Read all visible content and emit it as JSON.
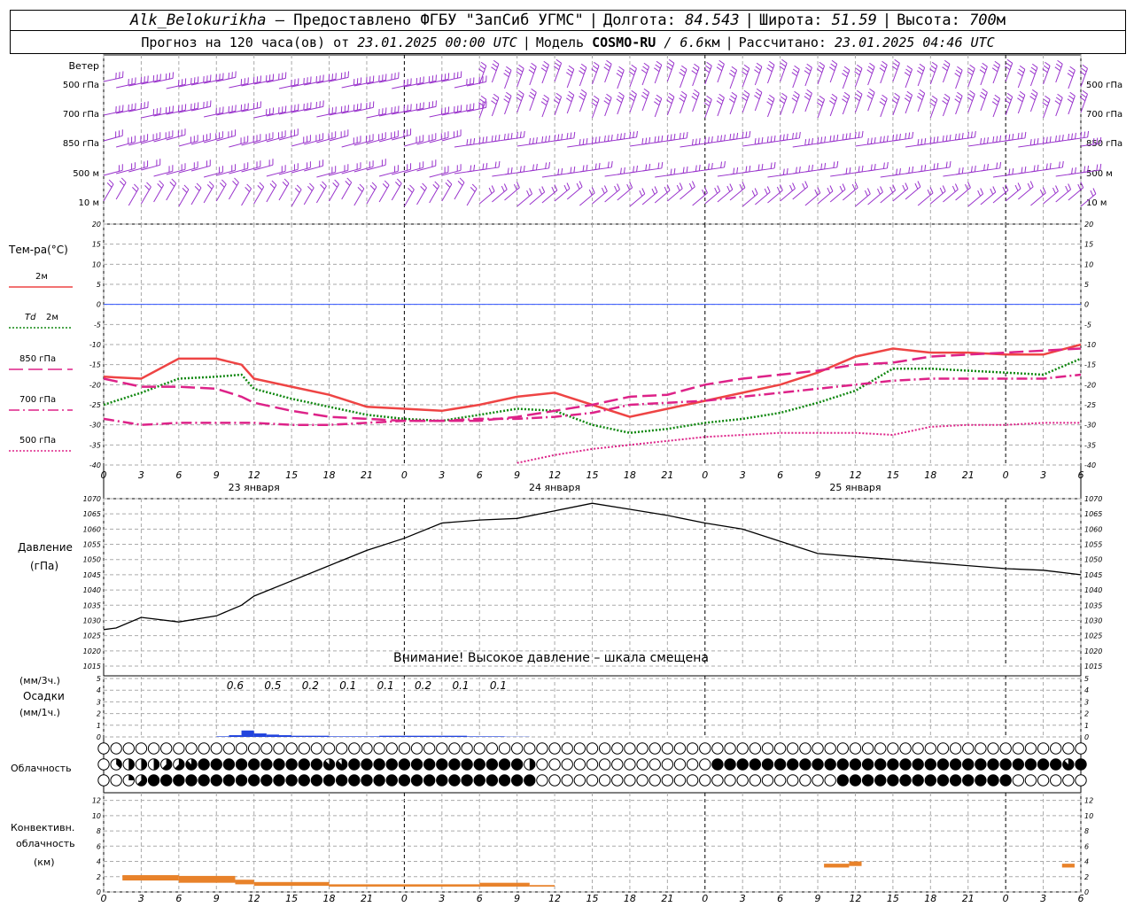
{
  "header": {
    "station": "Alk_Belokurikha",
    "provider": "– Предоставлено ФГБУ \"ЗапСиб УГМС\"",
    "lon_label": "Долгота:",
    "lon_value": "84.543",
    "lat_label": "Широта:",
    "lat_value": "51.59",
    "alt_label": "Высота:",
    "alt_value": "700",
    "alt_unit": "м",
    "forecast_label": "Прогноз на 120 часа(ов) от",
    "forecast_start": "23.01.2025 00:00 UTC",
    "model_label": "Модель",
    "model_name": "COSMO-RU",
    "model_res": "/ 6.6",
    "model_res_unit": "км",
    "calc_label": "Рассчитано:",
    "calc_time": "23.01.2025 04:46 UTC"
  },
  "colors": {
    "wind": "#9933cc",
    "t2m": "#ee4444",
    "td2m": "#118811",
    "t850": "#dd2288",
    "t700": "#dd2288",
    "t500": "#dd2288",
    "zero_line": "#3355ff",
    "pressure": "#000000",
    "precip": "#2244dd",
    "convective": "#e8822a",
    "grid": "#aaaaaa"
  },
  "chart_data": [
    {
      "type": "line",
      "name": "wind",
      "title": "Ветер",
      "levels": [
        "500 гПа",
        "700 гПа",
        "850 гПа",
        "500 м",
        "10 м"
      ],
      "symbol": "wind-barbs"
    },
    {
      "type": "line",
      "title": "Тем-ра(°C)",
      "x_ticks": [
        "0",
        "3",
        "6",
        "9",
        "12",
        "15",
        "18",
        "21",
        "0",
        "3",
        "6",
        "9",
        "12",
        "15",
        "18",
        "21",
        "0",
        "3",
        "6",
        "9",
        "12",
        "15",
        "18",
        "21",
        "0",
        "3",
        "6"
      ],
      "day_labels": [
        "23 января",
        "24 января",
        "25 января"
      ],
      "ylim": [
        -40,
        20
      ],
      "y_ticks": [
        20,
        15,
        10,
        5,
        0,
        -5,
        -10,
        -15,
        -20,
        -25,
        -30,
        -35,
        -40
      ],
      "series": [
        {
          "name": "2м",
          "legend_prefix": "",
          "key": "t2m",
          "style": "solid",
          "x": [
            0,
            3,
            6,
            9,
            11,
            12,
            15,
            18,
            21,
            24,
            27,
            30,
            33,
            36,
            39,
            42,
            45,
            48,
            51,
            54,
            57,
            60,
            63,
            66,
            69,
            72,
            75,
            78
          ],
          "y": [
            -18,
            -18.5,
            -13.5,
            -13.5,
            -15,
            -18.5,
            -20.5,
            -22.5,
            -25.5,
            -26,
            -26.5,
            -25,
            -23,
            -22,
            -25,
            -28,
            -26,
            -24,
            -22,
            -20,
            -17,
            -13,
            -11,
            -12,
            -12,
            -12.5,
            -12.5,
            -10
          ]
        },
        {
          "name": "2м",
          "legend_prefix": "Td",
          "key": "td2m",
          "style": "dot",
          "x": [
            0,
            3,
            6,
            9,
            11,
            12,
            15,
            18,
            21,
            24,
            27,
            30,
            33,
            36,
            39,
            42,
            45,
            48,
            51,
            54,
            57,
            60,
            63,
            66,
            69,
            72,
            75,
            78
          ],
          "y": [
            -25,
            -22,
            -18.5,
            -18,
            -17.5,
            -21,
            -23.5,
            -25.5,
            -27.5,
            -28.5,
            -29,
            -27.5,
            -26,
            -26.5,
            -30,
            -32,
            -31,
            -29.5,
            -28.5,
            -27,
            -24.5,
            -21.5,
            -16,
            -16,
            -16.5,
            -17,
            -17.5,
            -13.5
          ]
        },
        {
          "name": "850 гПа",
          "legend_prefix": "",
          "key": "t850",
          "style": "dash",
          "x": [
            0,
            3,
            6,
            9,
            11,
            12,
            15,
            18,
            21,
            24,
            27,
            30,
            33,
            36,
            39,
            42,
            45,
            48,
            51,
            54,
            57,
            60,
            63,
            66,
            69,
            72,
            75,
            78
          ],
          "y": [
            -18.5,
            -20.5,
            -20.5,
            -21,
            -23,
            -24.5,
            -26.5,
            -28,
            -28.5,
            -29,
            -29,
            -29,
            -28,
            -26.5,
            -25,
            -23,
            -22.5,
            -20,
            -18.5,
            -17.5,
            -16.5,
            -15,
            -14.5,
            -13,
            -12.5,
            -12,
            -11.5,
            -11
          ]
        },
        {
          "name": "700 гПа",
          "legend_prefix": "",
          "key": "t700",
          "style": "dashdot",
          "x": [
            0,
            3,
            6,
            9,
            12,
            15,
            18,
            21,
            24,
            27,
            30,
            33,
            36,
            39,
            42,
            45,
            48,
            51,
            54,
            57,
            60,
            63,
            66,
            69,
            72,
            75,
            78
          ],
          "y": [
            -28.5,
            -30,
            -29.5,
            -29.5,
            -29.5,
            -30,
            -30,
            -29.5,
            -29,
            -29,
            -28.5,
            -28.5,
            -28,
            -27,
            -25,
            -24.5,
            -24,
            -23,
            -22,
            -21,
            -20,
            -19,
            -18.5,
            -18.5,
            -18.5,
            -18.5,
            -17.5
          ]
        },
        {
          "name": "500 гПа",
          "legend_prefix": "",
          "key": "t500",
          "style": "dot",
          "x": [
            33,
            36,
            39,
            42,
            45,
            48,
            51,
            54,
            57,
            60,
            63,
            66,
            69,
            72,
            75,
            78
          ],
          "y": [
            -39.5,
            -37.5,
            -36,
            -35,
            -34,
            -33,
            -32.5,
            -32,
            -32,
            -32,
            -32.5,
            -30.5,
            -30,
            -30,
            -29.5,
            -29.5
          ]
        }
      ]
    },
    {
      "type": "line",
      "title": "Давление",
      "ylabel": "(гПа)",
      "ylim": [
        1015,
        1070
      ],
      "y_ticks": [
        1070,
        1065,
        1060,
        1055,
        1050,
        1045,
        1040,
        1035,
        1030,
        1025,
        1020,
        1015
      ],
      "series": [
        {
          "name": "Давление",
          "key": "pressure",
          "x": [
            0,
            1,
            3,
            6,
            9,
            11,
            12,
            15,
            18,
            21,
            24,
            27,
            30,
            33,
            36,
            39,
            42,
            45,
            48,
            51,
            54,
            57,
            60,
            63,
            66,
            69,
            72,
            75,
            78
          ],
          "y": [
            1027,
            1027.5,
            1031,
            1029.5,
            1031.5,
            1035,
            1038,
            1043,
            1048,
            1053,
            1057,
            1062,
            1063,
            1063.5,
            1066,
            1068.5,
            1066.5,
            1064.5,
            1062,
            1060,
            1056,
            1052,
            1051,
            1050,
            1049,
            1048,
            1047,
            1046.5,
            1045
          ]
        }
      ],
      "annotation": "Внимание! Высокое давление – шкала смещена"
    },
    {
      "type": "bar",
      "title": "Осадки",
      "ylabel_top": "(мм/3ч.)",
      "ylabel_bottom": "(мм/1ч.)",
      "ylim": [
        0,
        5
      ],
      "y_ticks": [
        5,
        4,
        3,
        2,
        1,
        0
      ],
      "sums_3h": [
        {
          "x": 10.5,
          "label": "0.6"
        },
        {
          "x": 13.5,
          "label": "0.5"
        },
        {
          "x": 16.5,
          "label": "0.2"
        },
        {
          "x": 19.5,
          "label": "0.1"
        },
        {
          "x": 22.5,
          "label": "0.1"
        },
        {
          "x": 25.5,
          "label": "0.2"
        },
        {
          "x": 28.5,
          "label": "0.1"
        },
        {
          "x": 31.5,
          "label": "0.1"
        }
      ],
      "hourly_x": [
        9,
        10,
        11,
        12,
        13,
        14,
        15,
        16,
        17,
        18,
        19,
        20,
        21,
        22,
        23,
        24,
        25,
        26,
        27,
        28,
        29,
        30,
        31,
        32,
        33
      ],
      "hourly_values": [
        0.05,
        0.15,
        0.55,
        0.3,
        0.2,
        0.15,
        0.1,
        0.1,
        0.1,
        0.05,
        0.05,
        0.05,
        0.05,
        0.1,
        0.1,
        0.1,
        0.1,
        0.1,
        0.1,
        0.1,
        0.05,
        0.05,
        0.05,
        0.02,
        0.02
      ]
    },
    {
      "type": "table",
      "title": "Облачность",
      "legend_note": "octas per hour, rows: upper / middle / lower",
      "rows": [
        [
          0,
          0,
          0,
          0,
          0,
          0,
          0,
          0,
          0,
          0,
          0,
          0,
          0,
          0,
          0,
          0,
          0,
          0,
          0,
          0,
          0,
          0,
          0,
          0,
          0,
          0,
          0,
          0,
          0,
          0,
          0,
          0,
          0,
          0,
          0,
          0,
          0,
          0,
          0,
          0,
          0,
          0,
          0,
          0,
          0,
          0,
          0,
          0,
          0,
          0,
          0,
          0,
          0,
          0,
          0,
          0,
          0,
          0,
          0,
          0,
          0,
          0,
          0,
          0,
          0,
          0,
          0,
          0,
          0,
          0,
          0,
          0,
          0,
          0,
          0,
          0,
          0,
          0,
          0
        ],
        [
          0,
          3,
          4,
          4,
          4,
          5,
          5,
          7,
          8,
          8,
          8,
          8,
          8,
          8,
          8,
          8,
          8,
          8,
          7,
          7,
          8,
          8,
          8,
          8,
          8,
          8,
          8,
          8,
          8,
          8,
          8,
          8,
          8,
          8,
          4,
          0,
          0,
          0,
          0,
          0,
          0,
          0,
          0,
          0,
          0,
          0,
          0,
          0,
          0,
          8,
          8,
          8,
          8,
          8,
          8,
          8,
          8,
          8,
          8,
          8,
          8,
          8,
          8,
          8,
          8,
          8,
          8,
          8,
          8,
          8,
          8,
          8,
          8,
          8,
          8,
          8,
          8,
          7,
          8
        ],
        [
          0,
          0,
          2,
          5,
          8,
          8,
          8,
          8,
          8,
          8,
          8,
          8,
          8,
          8,
          8,
          8,
          8,
          8,
          8,
          8,
          8,
          8,
          8,
          8,
          8,
          8,
          8,
          8,
          8,
          8,
          8,
          8,
          8,
          8,
          8,
          0,
          0,
          0,
          0,
          0,
          0,
          0,
          0,
          0,
          0,
          0,
          0,
          0,
          0,
          0,
          0,
          0,
          0,
          0,
          0,
          0,
          0,
          0,
          0,
          8,
          8,
          8,
          8,
          8,
          8,
          8,
          8,
          8,
          8,
          8,
          8,
          8,
          8,
          0,
          0,
          0,
          0,
          0,
          0
        ]
      ]
    },
    {
      "type": "bar",
      "title": "Конвективн.",
      "title2": "облачность",
      "ylabel": "(км)",
      "ylim": [
        0,
        13
      ],
      "y_ticks": [
        12,
        10,
        8,
        6,
        4,
        2,
        0
      ],
      "ranges": [
        {
          "x0": 1.5,
          "x1": 6,
          "lo": 1.5,
          "hi": 2.2
        },
        {
          "x0": 6,
          "x1": 10.5,
          "lo": 1.2,
          "hi": 2.1
        },
        {
          "x0": 10.5,
          "x1": 12,
          "lo": 1.0,
          "hi": 1.6
        },
        {
          "x0": 12,
          "x1": 18,
          "lo": 0.8,
          "hi": 1.3
        },
        {
          "x0": 18,
          "x1": 24,
          "lo": 0.7,
          "hi": 1.0
        },
        {
          "x0": 24,
          "x1": 30,
          "lo": 0.7,
          "hi": 1.0
        },
        {
          "x0": 30,
          "x1": 34,
          "lo": 0.7,
          "hi": 1.2
        },
        {
          "x0": 34,
          "x1": 36,
          "lo": 0.7,
          "hi": 0.9
        },
        {
          "x0": 57.5,
          "x1": 59.5,
          "lo": 3.2,
          "hi": 3.7
        },
        {
          "x0": 59.5,
          "x1": 60.5,
          "lo": 3.4,
          "hi": 4.0
        },
        {
          "x0": 76.5,
          "x1": 77.5,
          "lo": 3.2,
          "hi": 3.7
        }
      ]
    }
  ]
}
